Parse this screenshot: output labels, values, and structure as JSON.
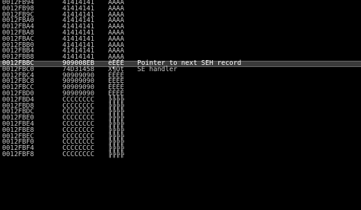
{
  "stack": {
    "rows": [
      {
        "address": "0012FB94",
        "value": "41414141",
        "ascii": "AAAA",
        "comment": ""
      },
      {
        "address": "0012FB98",
        "value": "41414141",
        "ascii": "AAAA",
        "comment": ""
      },
      {
        "address": "0012FB9C",
        "value": "41414141",
        "ascii": "AAAA",
        "comment": ""
      },
      {
        "address": "0012FBA0",
        "value": "41414141",
        "ascii": "AAAA",
        "comment": ""
      },
      {
        "address": "0012FBA4",
        "value": "41414141",
        "ascii": "AAAA",
        "comment": ""
      },
      {
        "address": "0012FBA8",
        "value": "41414141",
        "ascii": "AAAA",
        "comment": ""
      },
      {
        "address": "0012FBAC",
        "value": "41414141",
        "ascii": "AAAA",
        "comment": ""
      },
      {
        "address": "0012FBB0",
        "value": "41414141",
        "ascii": "AAAA",
        "comment": ""
      },
      {
        "address": "0012FBB4",
        "value": "41414141",
        "ascii": "AAAA",
        "comment": ""
      },
      {
        "address": "0012FBB8",
        "value": "41414141",
        "ascii": "AAAA",
        "comment": ""
      },
      {
        "address": "0012FBBC",
        "value": "909008EB",
        "ascii": "ëÉÉÉ",
        "comment": "Pointer to next SEH record",
        "selected": true
      },
      {
        "address": "0012FBC0",
        "value": "74D31458",
        "ascii": "X¶Ót",
        "comment": "SE handler"
      },
      {
        "address": "0012FBC4",
        "value": "90909090",
        "ascii": "ÉÉÉÉ",
        "comment": ""
      },
      {
        "address": "0012FBC8",
        "value": "90909090",
        "ascii": "ÉÉÉÉ",
        "comment": ""
      },
      {
        "address": "0012FBCC",
        "value": "90909090",
        "ascii": "ÉÉÉÉ",
        "comment": ""
      },
      {
        "address": "0012FBD0",
        "value": "90909090",
        "ascii": "ÉÉÉÉ",
        "comment": ""
      },
      {
        "address": "0012FBD4",
        "value": "CCCCCCCC",
        "ascii": "╠╠╠╠",
        "comment": ""
      },
      {
        "address": "0012FBD8",
        "value": "CCCCCCCC",
        "ascii": "╠╠╠╠",
        "comment": ""
      },
      {
        "address": "0012FBDC",
        "value": "CCCCCCCC",
        "ascii": "╠╠╠╠",
        "comment": ""
      },
      {
        "address": "0012FBE0",
        "value": "CCCCCCCC",
        "ascii": "╠╠╠╠",
        "comment": ""
      },
      {
        "address": "0012FBE4",
        "value": "CCCCCCCC",
        "ascii": "╠╠╠╠",
        "comment": ""
      },
      {
        "address": "0012FBE8",
        "value": "CCCCCCCC",
        "ascii": "╠╠╠╠",
        "comment": ""
      },
      {
        "address": "0012FBEC",
        "value": "CCCCCCCC",
        "ascii": "╠╠╠╠",
        "comment": ""
      },
      {
        "address": "0012FBF0",
        "value": "CCCCCCCC",
        "ascii": "╠╠╠╠",
        "comment": ""
      },
      {
        "address": "0012FBF4",
        "value": "CCCCCCCC",
        "ascii": "╠╠╠╠",
        "comment": ""
      },
      {
        "address": "0012FBF8",
        "value": "CCCCCCCC",
        "ascii": "╠╠╠╠",
        "comment": ""
      }
    ]
  },
  "colors": {
    "background": "#000000",
    "text": "#c7c7c7",
    "selected_row": "#3a3a3a",
    "selected_text": "#ffffff"
  }
}
